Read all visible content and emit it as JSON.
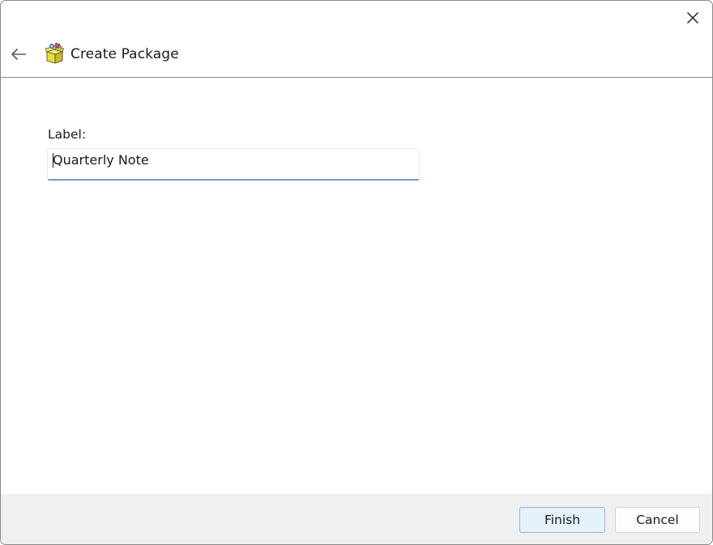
{
  "window": {
    "close_icon": "close-icon"
  },
  "header": {
    "back_icon": "back-arrow-icon",
    "app_icon": "package-box-icon",
    "title": "Create Package"
  },
  "form": {
    "label_field": {
      "label": "Label:",
      "value": "Quarterly Note",
      "placeholder": ""
    }
  },
  "footer": {
    "finish_label": "Finish",
    "cancel_label": "Cancel"
  },
  "colors": {
    "accent": "#6d9fd6",
    "default_button_bg": "#e5f1fb",
    "default_button_border": "#8ab8e0",
    "footer_bg": "#f0f0f0"
  }
}
